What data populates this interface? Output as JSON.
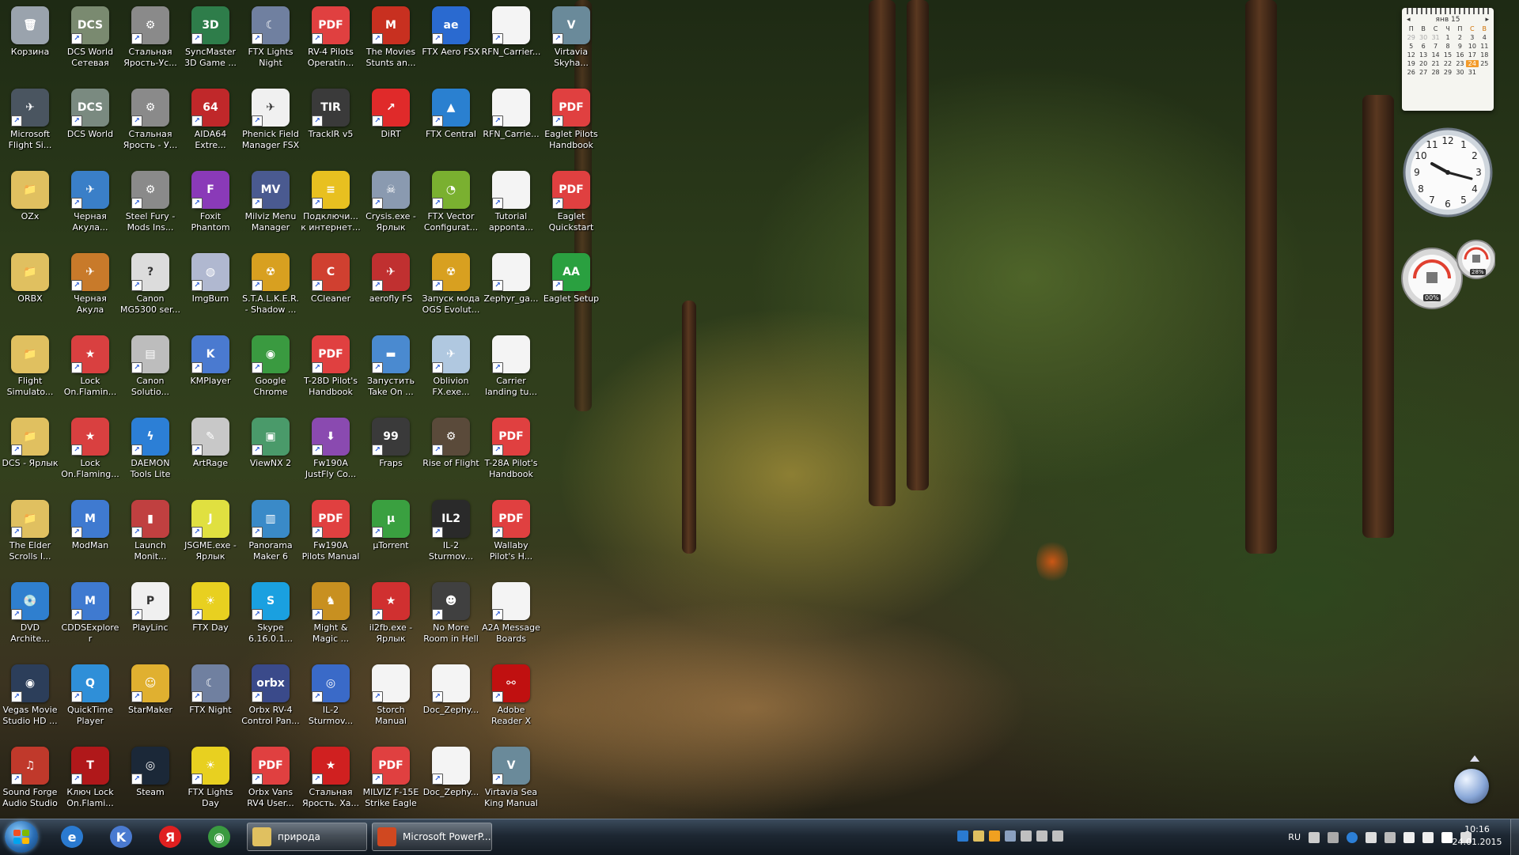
{
  "desktop": {
    "columns": [
      [
        {
          "label": "Корзина",
          "color": "#9aa3ad",
          "glyph": "🗑",
          "shortcut": false
        },
        {
          "label": "Microsoft Flight Si...",
          "color": "#4a5560",
          "glyph": "✈",
          "shortcut": true
        },
        {
          "label": "OZx",
          "color": "#e0c060",
          "glyph": "📁",
          "shortcut": false
        },
        {
          "label": "ORBX",
          "color": "#e0c060",
          "glyph": "📁",
          "shortcut": false
        },
        {
          "label": "Flight Simulato...",
          "color": "#e0c060",
          "glyph": "📁",
          "shortcut": false
        },
        {
          "label": "DCS - Ярлык",
          "color": "#e0c060",
          "glyph": "📁",
          "shortcut": true
        },
        {
          "label": "The Elder Scrolls I...",
          "color": "#e0c060",
          "glyph": "📁",
          "shortcut": true
        },
        {
          "label": "DVD Archite...",
          "color": "#2f7fcf",
          "glyph": "💿",
          "shortcut": true
        },
        {
          "label": "Vegas Movie Studio HD ...",
          "color": "#2c3e5a",
          "glyph": "◉",
          "shortcut": true
        },
        {
          "label": "Sound Forge Audio Studio",
          "color": "#c0392b",
          "glyph": "♫",
          "shortcut": true
        }
      ],
      [
        {
          "label": "DCS World Сетевая игра",
          "color": "#7a8a70",
          "glyph": "DCS",
          "shortcut": true
        },
        {
          "label": "DCS World",
          "color": "#7a8a80",
          "glyph": "DCS",
          "shortcut": true
        },
        {
          "label": "Черная Акула...",
          "color": "#3a7fc8",
          "glyph": "✈",
          "shortcut": true
        },
        {
          "label": "Черная Акула",
          "color": "#c87a2a",
          "glyph": "✈",
          "shortcut": true
        },
        {
          "label": "Lock On.Flamin...",
          "color": "#d94040",
          "glyph": "★",
          "shortcut": true
        },
        {
          "label": "Lock On.Flaming...",
          "color": "#d94040",
          "glyph": "★",
          "shortcut": true
        },
        {
          "label": "ModMan",
          "color": "#3f7ad0",
          "glyph": "M",
          "shortcut": true
        },
        {
          "label": "CDDSExplorer",
          "color": "#3f7ad0",
          "glyph": "M",
          "shortcut": true
        },
        {
          "label": "QuickTime Player",
          "color": "#2f8fd8",
          "glyph": "Q",
          "shortcut": true
        },
        {
          "label": "Ключ Lock On.Flami...",
          "color": "#b0181a",
          "glyph": "T",
          "shortcut": true
        }
      ],
      [
        {
          "label": "Стальная Ярость-Ус...",
          "color": "#8a8a8a",
          "glyph": "⚙",
          "shortcut": true
        },
        {
          "label": "Стальная Ярость - У...",
          "color": "#8a8a8a",
          "glyph": "⚙",
          "shortcut": true
        },
        {
          "label": "Steel Fury - Mods Ins...",
          "color": "#8a8a8a",
          "glyph": "⚙",
          "shortcut": true
        },
        {
          "label": "Canon MG5300 ser...",
          "color": "#dcdcdc",
          "glyph": "?",
          "shortcut": true
        },
        {
          "label": "Canon Solutio...",
          "color": "#bdbdbd",
          "glyph": "▤",
          "shortcut": true
        },
        {
          "label": "DAEMON Tools Lite",
          "color": "#2c7fd6",
          "glyph": "ϟ",
          "shortcut": true
        },
        {
          "label": "Launch Monit...",
          "color": "#c04040",
          "glyph": "▮",
          "shortcut": true
        },
        {
          "label": "PlayLinc",
          "color": "#f0f0f0",
          "glyph": "P",
          "shortcut": true
        },
        {
          "label": "StarMaker",
          "color": "#e0b030",
          "glyph": "☺",
          "shortcut": true
        },
        {
          "label": "Steam",
          "color": "#1b2838",
          "glyph": "◎",
          "shortcut": true
        }
      ],
      [
        {
          "label": "SyncMaster 3D Game ...",
          "color": "#2e7d4a",
          "glyph": "3D",
          "shortcut": true
        },
        {
          "label": "AIDA64 Extre...",
          "color": "#c0282a",
          "glyph": "64",
          "shortcut": true
        },
        {
          "label": "Foxit Phantom",
          "color": "#8a3ab8",
          "glyph": "F",
          "shortcut": true
        },
        {
          "label": "ImgBurn",
          "color": "#b0b8d0",
          "glyph": "◍",
          "shortcut": true
        },
        {
          "label": "KMPlayer",
          "color": "#4a7ad0",
          "glyph": "K",
          "shortcut": true
        },
        {
          "label": "ArtRage",
          "color": "#c8c8c8",
          "glyph": "✎",
          "shortcut": true
        },
        {
          "label": "JSGME.exe - Ярлык",
          "color": "#e0e040",
          "glyph": "J",
          "shortcut": true
        },
        {
          "label": "FTX Day",
          "color": "#e8d020",
          "glyph": "☀",
          "shortcut": true
        },
        {
          "label": "FTX Night",
          "color": "#7080a0",
          "glyph": "☾",
          "shortcut": true
        },
        {
          "label": "FTX Lights Day",
          "color": "#e8d020",
          "glyph": "☀",
          "shortcut": true
        }
      ],
      [
        {
          "label": "FTX Lights Night",
          "color": "#7080a0",
          "glyph": "☾",
          "shortcut": true
        },
        {
          "label": "Phenick Field Manager FSX",
          "color": "#f0f0f0",
          "glyph": "✈",
          "shortcut": true
        },
        {
          "label": "Milviz Menu Manager",
          "color": "#4a5a90",
          "glyph": "MV",
          "shortcut": true
        },
        {
          "label": "S.T.A.L.K.E.R. - Shadow ...",
          "color": "#d8a020",
          "glyph": "☢",
          "shortcut": true
        },
        {
          "label": "Google Chrome",
          "color": "#3a9a40",
          "glyph": "◉",
          "shortcut": true
        },
        {
          "label": "ViewNX 2",
          "color": "#4a9a6a",
          "glyph": "▣",
          "shortcut": true
        },
        {
          "label": "Panorama Maker 6",
          "color": "#3a8ac8",
          "glyph": "▥",
          "shortcut": true
        },
        {
          "label": "Skype 6.16.0.1...",
          "color": "#1aa0e0",
          "glyph": "S",
          "shortcut": true
        },
        {
          "label": "Orbx RV-4 Control Pan...",
          "color": "#3a4a8a",
          "glyph": "orbx",
          "shortcut": true
        },
        {
          "label": "Orbx Vans RV4 User...",
          "color": "#e04040",
          "glyph": "PDF",
          "shortcut": true
        }
      ],
      [
        {
          "label": "RV-4 Pilots Operatin...",
          "color": "#e04040",
          "glyph": "PDF",
          "shortcut": true
        },
        {
          "label": "TrackIR v5",
          "color": "#3a3a3a",
          "glyph": "TIR",
          "shortcut": true
        },
        {
          "label": "Подключи... к интернет...",
          "color": "#e8c020",
          "glyph": "≡",
          "shortcut": true
        },
        {
          "label": "CCleaner",
          "color": "#d04030",
          "glyph": "C",
          "shortcut": true
        },
        {
          "label": "T-28D Pilot's Handbook",
          "color": "#e04040",
          "glyph": "PDF",
          "shortcut": true
        },
        {
          "label": "Fw190A JustFly Co...",
          "color": "#8a4ab0",
          "glyph": "⬇",
          "shortcut": true
        },
        {
          "label": "Fw190A Pilots Manual",
          "color": "#e04040",
          "glyph": "PDF",
          "shortcut": true
        },
        {
          "label": "Might & Magic ...",
          "color": "#c89020",
          "glyph": "♞",
          "shortcut": true
        },
        {
          "label": "IL-2 Sturmov...",
          "color": "#3a6ac8",
          "glyph": "◎",
          "shortcut": true
        },
        {
          "label": "Стальная Ярость. Ха...",
          "color": "#d02020",
          "glyph": "★",
          "shortcut": true
        }
      ],
      [
        {
          "label": "The Movies Stunts an...",
          "color": "#c83020",
          "glyph": "M",
          "shortcut": true
        },
        {
          "label": "DiRT",
          "color": "#e02a2a",
          "glyph": "↗",
          "shortcut": true
        },
        {
          "label": "Crysis.exe - Ярлык",
          "color": "#8a9ab0",
          "glyph": "☠",
          "shortcut": true
        },
        {
          "label": "aerofly FS",
          "color": "#c03030",
          "glyph": "✈",
          "shortcut": true
        },
        {
          "label": "Запустить Take On ...",
          "color": "#4a8ad0",
          "glyph": "▬",
          "shortcut": true
        },
        {
          "label": "Fraps",
          "color": "#3a3a3a",
          "glyph": "99",
          "shortcut": true
        },
        {
          "label": "µTorrent",
          "color": "#3aa040",
          "glyph": "µ",
          "shortcut": true
        },
        {
          "label": "il2fb.exe - Ярлык",
          "color": "#d03030",
          "glyph": "★",
          "shortcut": true
        },
        {
          "label": "Storch Manual",
          "color": "#f4f4f4",
          "glyph": "",
          "shortcut": true
        },
        {
          "label": "MILVIZ F-15E Strike Eagle",
          "color": "#e04040",
          "glyph": "PDF",
          "shortcut": true
        }
      ],
      [
        {
          "label": "FTX Aero FSX",
          "color": "#2a6ad0",
          "glyph": "ae",
          "shortcut": true
        },
        {
          "label": "FTX Central",
          "color": "#2a80d0",
          "glyph": "▲",
          "shortcut": true
        },
        {
          "label": "FTX Vector Configurat...",
          "color": "#7ab030",
          "glyph": "◔",
          "shortcut": true
        },
        {
          "label": "Запуск мода OGS Evolut...",
          "color": "#d8a020",
          "glyph": "☢",
          "shortcut": true
        },
        {
          "label": "Oblivion FX.exe...",
          "color": "#b0c8e0",
          "glyph": "✈",
          "shortcut": true
        },
        {
          "label": "Rise of Flight",
          "color": "#5a4a3a",
          "glyph": "⚙",
          "shortcut": true
        },
        {
          "label": "IL-2 Sturmov...",
          "color": "#2a2a2a",
          "glyph": "IL2",
          "shortcut": true
        },
        {
          "label": "No More Room in Hell",
          "color": "#404040",
          "glyph": "☻",
          "shortcut": true
        },
        {
          "label": "Doc_Zephy...",
          "color": "#f4f4f4",
          "glyph": "",
          "shortcut": true
        },
        {
          "label": "Doc_Zephy...",
          "color": "#f4f4f4",
          "glyph": "",
          "shortcut": true
        }
      ],
      [
        {
          "label": "RFN_Carrier...",
          "color": "#f4f4f4",
          "glyph": "",
          "shortcut": true
        },
        {
          "label": "RFN_Carrie...",
          "color": "#f4f4f4",
          "glyph": "",
          "shortcut": true
        },
        {
          "label": "Tutorial apponta...",
          "color": "#f4f4f4",
          "glyph": "",
          "shortcut": true
        },
        {
          "label": "Zephyr_ga...",
          "color": "#f4f4f4",
          "glyph": "",
          "shortcut": true
        },
        {
          "label": "Carrier landing tu...",
          "color": "#f4f4f4",
          "glyph": "",
          "shortcut": true
        },
        {
          "label": "T-28A Pilot's Handbook",
          "color": "#e04040",
          "glyph": "PDF",
          "shortcut": true
        },
        {
          "label": "Wallaby Pilot's H...",
          "color": "#e04040",
          "glyph": "PDF",
          "shortcut": true
        },
        {
          "label": "A2A Message Boards",
          "color": "#f4f4f4",
          "glyph": "",
          "shortcut": true
        },
        {
          "label": "Adobe Reader X",
          "color": "#c01010",
          "glyph": "⚯",
          "shortcut": true
        },
        {
          "label": "Virtavia Sea King Manual",
          "color": "#6a8a9a",
          "glyph": "V",
          "shortcut": true
        }
      ],
      [
        {
          "label": "Virtavia Skyha...",
          "color": "#6a8a9a",
          "glyph": "V",
          "shortcut": true
        },
        {
          "label": "Eaglet Pilots Handbook",
          "color": "#e04040",
          "glyph": "PDF",
          "shortcut": true
        },
        {
          "label": "Eaglet Quickstart",
          "color": "#e04040",
          "glyph": "PDF",
          "shortcut": true
        },
        {
          "label": "Eaglet Setup",
          "color": "#2aa040",
          "glyph": "AA",
          "shortcut": true
        }
      ]
    ]
  },
  "gadgets": {
    "calendar": {
      "month": "янв 15",
      "weekdays": [
        "П",
        "В",
        "С",
        "Ч",
        "П",
        "С",
        "В"
      ],
      "days": [
        [
          "29",
          "30",
          "31",
          "1",
          "2",
          "3",
          "4"
        ],
        [
          "5",
          "6",
          "7",
          "8",
          "9",
          "10",
          "11"
        ],
        [
          "12",
          "13",
          "14",
          "15",
          "16",
          "17",
          "18"
        ],
        [
          "19",
          "20",
          "21",
          "22",
          "23",
          "24",
          "25"
        ],
        [
          "26",
          "27",
          "28",
          "29",
          "30",
          "31",
          ""
        ]
      ],
      "today": "24"
    },
    "meter": {
      "cpu": "00%",
      "ram": "28%"
    }
  },
  "taskbar": {
    "pinned": [
      {
        "name": "internet-explorer-icon",
        "color": "#2a7ad0",
        "glyph": "e"
      },
      {
        "name": "kmplayer-icon",
        "color": "#4a7ad0",
        "glyph": "K"
      },
      {
        "name": "yandex-icon",
        "color": "#e02020",
        "glyph": "Я"
      },
      {
        "name": "chrome-icon",
        "color": "#3a9a40",
        "glyph": "◉"
      }
    ],
    "tasks": [
      {
        "label": "природа",
        "color": "#e0c060"
      },
      {
        "label": "Microsoft PowerP...",
        "color": "#d04820"
      }
    ],
    "tray": {
      "language": "RU"
    },
    "clock": {
      "time": "10:16",
      "date": "24.01.2015"
    }
  },
  "colors": {
    "taskbar": "#1d2732",
    "accent": "#f39b2a"
  }
}
